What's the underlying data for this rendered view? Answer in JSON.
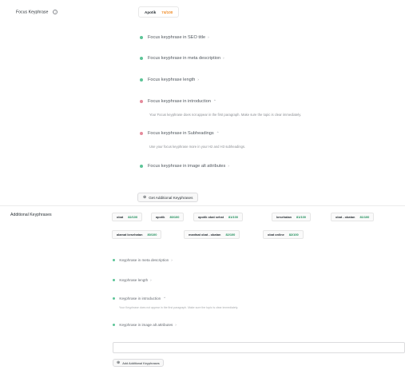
{
  "focus": {
    "label": "Focus Keyphrase",
    "info_icon": "ⓘ",
    "keyword": "Apotik",
    "score": "74/100",
    "checks": [
      {
        "status": "good",
        "text": "Focus keyphrase in SEO title",
        "chevron": "›",
        "desc": ""
      },
      {
        "status": "good",
        "text": "Focus keyphrase in meta description",
        "chevron": "›",
        "desc": ""
      },
      {
        "status": "good",
        "text": "Focus keyphrase length",
        "chevron": "›",
        "desc": ""
      },
      {
        "status": "bad",
        "text": "Focus keyphrase in introduction",
        "chevron": "⌃",
        "desc": "Your Focus keyphrase does not appear in the first paragraph. Make sure the topic is clear immediately."
      },
      {
        "status": "bad",
        "text": "Focus keyphrase in Subheadings",
        "chevron": "⌃",
        "desc": "Use your focus keyphrase more in your H2 and H3 subheadings."
      },
      {
        "status": "good",
        "text": "Focus keyphrase in image alt attributes",
        "chevron": "›",
        "desc": ""
      }
    ],
    "add_button": "Get Additional Keyphrases",
    "add_icon": "⊕"
  },
  "additional": {
    "label": "Additional Keyphrases",
    "tags": [
      {
        "keyword": "obat",
        "score": "82/100"
      },
      {
        "keyword": "apotik",
        "score": "80/100"
      },
      {
        "keyword": "apotik obat sehat",
        "score": "81/100"
      },
      {
        "keyword": "kesehatan",
        "score": "81/100"
      },
      {
        "keyword": "obat - obatan",
        "score": "81/100"
      },
      {
        "keyword": "alamat kesehatan",
        "score": "80/100"
      },
      {
        "keyword": "manfaat obat - obatan",
        "score": "82/100"
      },
      {
        "keyword": "obat online",
        "score": "82/100"
      }
    ],
    "checks": [
      {
        "status": "good",
        "text": "Keyphrase in meta description",
        "chevron": "›",
        "desc": ""
      },
      {
        "status": "good",
        "text": "Keyphrase length",
        "chevron": "›",
        "desc": ""
      },
      {
        "status": "good",
        "text": "Keyphrase in introduction",
        "chevron": "⌃",
        "desc": "Your Keyphrase does not appear in the first paragraph. Make sure the topic is clear immediately."
      },
      {
        "status": "good",
        "text": "Keyphrase in image alt attributes",
        "chevron": "›",
        "desc": ""
      }
    ],
    "input_value": "",
    "add_button": "Add Additional Keyphrases",
    "add_icon": "⊕"
  }
}
